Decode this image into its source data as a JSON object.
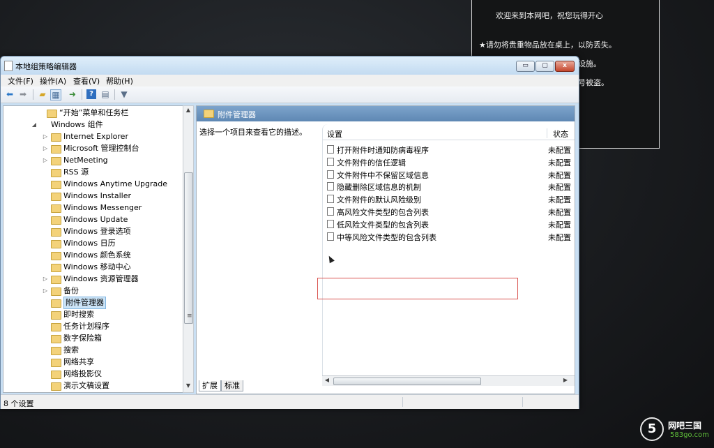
{
  "notice": {
    "line1": "欢迎来到本网吧，祝您玩得开心",
    "line2": "★请勿将贵重物品放在桌上，以防丢失。",
    "line3": "设施。",
    "line4": "号被盗。"
  },
  "window": {
    "title": "本地组策略编辑器",
    "buttons": {
      "minimize": "▭",
      "maximize": "▢",
      "close": "x"
    }
  },
  "menu": [
    "文件(F)",
    "操作(A)",
    "查看(V)",
    "帮助(H)"
  ],
  "toolbar_icons": [
    "back-arrow-icon",
    "forward-arrow-icon",
    "up-folder-icon",
    "show-hide-tree-icon",
    "export-list-icon",
    "help-icon",
    "properties-icon",
    "filter-icon"
  ],
  "tree": {
    "items": [
      {
        "label": "“开始”菜单和任务栏",
        "expander": ""
      },
      {
        "label": "Windows 组件",
        "expander": "◢"
      },
      {
        "label": "Internet Explorer",
        "expander": "▷"
      },
      {
        "label": "Microsoft 管理控制台",
        "expander": "▷"
      },
      {
        "label": "NetMeeting",
        "expander": "▷"
      },
      {
        "label": "RSS 源",
        "expander": ""
      },
      {
        "label": "Windows Anytime Upgrade",
        "expander": ""
      },
      {
        "label": "Windows Installer",
        "expander": ""
      },
      {
        "label": "Windows Messenger",
        "expander": ""
      },
      {
        "label": "Windows Update",
        "expander": ""
      },
      {
        "label": "Windows 登录选项",
        "expander": ""
      },
      {
        "label": "Windows 日历",
        "expander": ""
      },
      {
        "label": "Windows 颜色系统",
        "expander": ""
      },
      {
        "label": "Windows 移动中心",
        "expander": ""
      },
      {
        "label": "Windows 资源管理器",
        "expander": "▷"
      },
      {
        "label": "备份",
        "expander": "▷"
      },
      {
        "label": "附件管理器",
        "expander": "",
        "selected": true
      },
      {
        "label": "即时搜索",
        "expander": ""
      },
      {
        "label": "任务计划程序",
        "expander": ""
      },
      {
        "label": "数字保险箱",
        "expander": ""
      },
      {
        "label": "搜索",
        "expander": ""
      },
      {
        "label": "网络共享",
        "expander": ""
      },
      {
        "label": "网络投影仪",
        "expander": ""
      },
      {
        "label": "演示文稿设置",
        "expander": ""
      }
    ]
  },
  "right": {
    "header": "附件管理器",
    "description": "选择一个项目来查看它的描述。",
    "col_setting": "设置",
    "col_state": "状态",
    "rows": [
      {
        "name": "打开附件时通知防病毒程序",
        "state": "未配置"
      },
      {
        "name": "文件附件的信任逻辑",
        "state": "未配置"
      },
      {
        "name": "文件附件中不保留区域信息",
        "state": "未配置"
      },
      {
        "name": "隐藏删除区域信息的机制",
        "state": "未配置"
      },
      {
        "name": "文件附件的默认风险级别",
        "state": "未配置"
      },
      {
        "name": "高风险文件类型的包含列表",
        "state": "未配置"
      },
      {
        "name": "低风险文件类型的包含列表",
        "state": "未配置"
      },
      {
        "name": "中等风险文件类型的包含列表",
        "state": "未配置"
      }
    ],
    "tabs": [
      "扩展",
      "标准"
    ]
  },
  "status": {
    "text": "8 个设置"
  },
  "watermark": {
    "logo": "5",
    "title": "网吧三国",
    "sub": "583go.com"
  }
}
